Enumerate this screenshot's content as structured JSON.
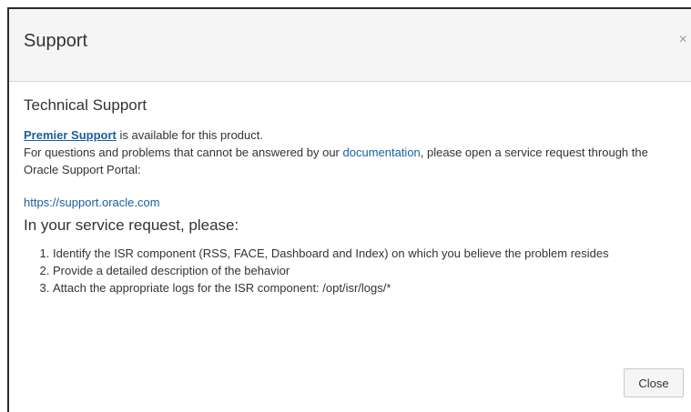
{
  "dialog": {
    "title": "Support",
    "close_glyph": "×"
  },
  "body": {
    "section_title": "Technical Support",
    "premier_link": "Premier Support",
    "premier_suffix": " is available for this product.",
    "questions_prefix": "For questions and problems that cannot be answered by our ",
    "documentation_link": "documentation",
    "questions_suffix": ", please open a service request through the Oracle Support Portal:",
    "support_url": "https://support.oracle.com",
    "request_title": "In your service request, please:",
    "steps": [
      "Identify the ISR component (RSS, FACE, Dashboard and Index) on which you believe the problem resides",
      "Provide a detailed description of the behavior",
      "Attach the appropriate logs for the ISR component: /opt/isr/logs/*"
    ]
  },
  "footer": {
    "close_label": "Close"
  },
  "colors": {
    "link": "#1a5f9e",
    "header_bg": "#f5f5f5",
    "text": "#333333"
  }
}
